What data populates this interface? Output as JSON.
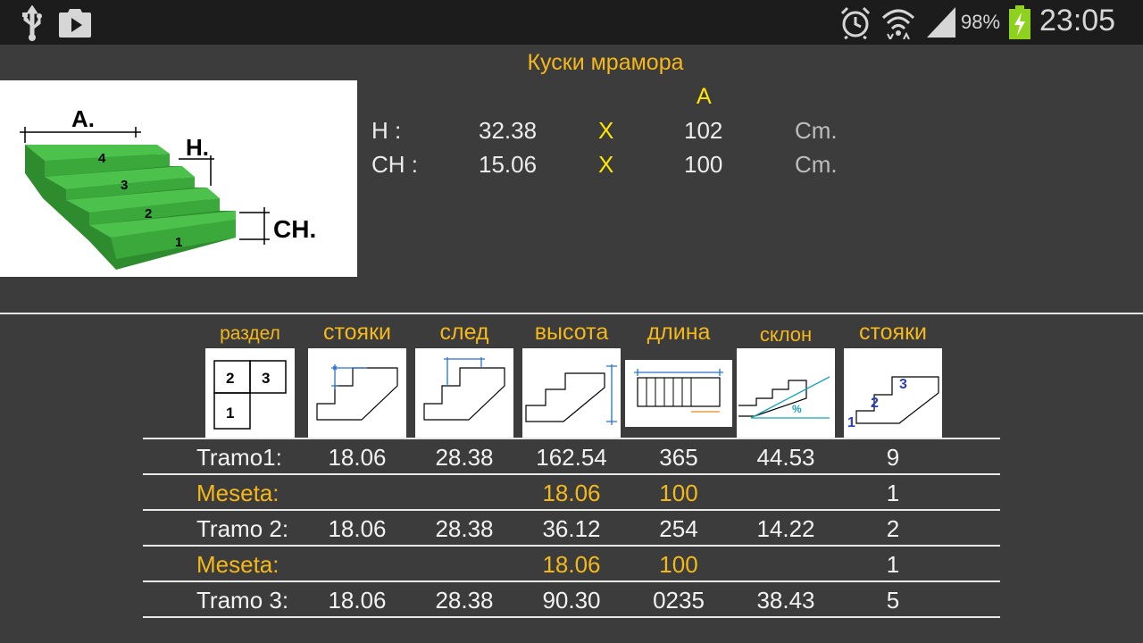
{
  "status_bar": {
    "battery": "98%",
    "time": "23:05",
    "icons": [
      "usb-icon",
      "play-store-icon",
      "alarm-icon",
      "wifi-icon",
      "signal-icon",
      "battery-charging-icon"
    ]
  },
  "title": "Куски мрамора",
  "figure": {
    "labels": {
      "a": "A.",
      "h": "H.",
      "ch": "CH."
    },
    "step_numbers": [
      "1",
      "2",
      "3",
      "4"
    ],
    "colors": {
      "stairs": "#3a9e3a",
      "stairs_top": "#4cc24c"
    }
  },
  "pieces": {
    "col_header": "A",
    "rows": [
      {
        "label": "H :",
        "value": "32.38",
        "x": "X",
        "a": "102",
        "unit": "Cm."
      },
      {
        "label": "CH :",
        "value": "15.06",
        "x": "X",
        "a": "100",
        "unit": "Cm."
      }
    ]
  },
  "table": {
    "headers": [
      "раздел",
      "стояки",
      "след",
      "высота",
      "длина",
      "склон",
      "стояки"
    ],
    "icon_texts": {
      "section": [
        "2",
        "3",
        "1"
      ],
      "slope": "%",
      "risers": [
        "1",
        "2",
        "3"
      ]
    },
    "rows": [
      {
        "label": "Tramo1:",
        "cells": [
          "18.06",
          "28.38",
          "162.54",
          "365",
          "44.53",
          "9"
        ],
        "style": "white"
      },
      {
        "label": "Meseta:",
        "cells": [
          "",
          "",
          "18.06",
          "100",
          "",
          "1"
        ],
        "style": "mixed"
      },
      {
        "label": "Tramo 2:",
        "cells": [
          "18.06",
          "28.38",
          "36.12",
          "254",
          "14.22",
          "2"
        ],
        "style": "white"
      },
      {
        "label": "Meseta:",
        "cells": [
          "",
          "",
          "18.06",
          "100",
          "",
          "1"
        ],
        "style": "mixed"
      },
      {
        "label": "Tramo 3:",
        "cells": [
          "18.06",
          "28.38",
          "90.30",
          "0235",
          "38.43",
          "5"
        ],
        "style": "white"
      }
    ]
  },
  "colors": {
    "accent": "#f5b81b",
    "highlight": "#ffe600",
    "background": "#3c3c3c",
    "statusbar": "#1c1c1c"
  }
}
